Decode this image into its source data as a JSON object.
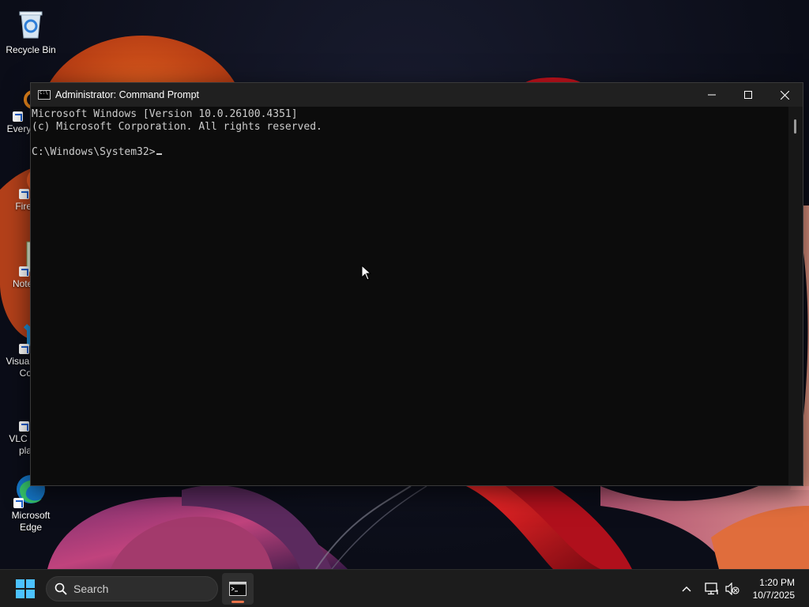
{
  "desktop": {
    "icons": [
      {
        "label": "Recycle Bin",
        "icon": "recycle-bin-icon"
      },
      {
        "label": "Every",
        "icon": "everything-icon"
      },
      {
        "label": "Fire",
        "icon": "firefox-icon"
      },
      {
        "label": "Notep",
        "icon": "notepad-plus-plus-icon"
      },
      {
        "label": "Visual",
        "label2": "Co",
        "icon": "vscode-icon"
      },
      {
        "label": "VLC r",
        "label2": "pla",
        "icon": "vlc-icon"
      },
      {
        "label": "Microsoft",
        "label2": "Edge",
        "icon": "edge-icon"
      }
    ]
  },
  "window": {
    "title": "Administrator: Command Prompt",
    "controls": {
      "minimize": "minimize-icon",
      "maximize": "maximize-icon",
      "close": "close-icon"
    },
    "console_lines": [
      "Microsoft Windows [Version 10.0.26100.4351]",
      "(c) Microsoft Corporation. All rights reserved.",
      "",
      "C:\\Windows\\System32>"
    ]
  },
  "taskbar": {
    "search_placeholder": "Search",
    "pinned": [
      {
        "name": "Command Prompt",
        "icon": "terminal-icon",
        "active": true
      }
    ],
    "tray": {
      "chevron": "chevron-up-icon",
      "network": "network-icon",
      "volume": "volume-muted-icon"
    },
    "clock": {
      "time": "1:20 PM",
      "date": "10/7/2025"
    }
  },
  "colors": {
    "console_bg": "#0c0c0c",
    "console_text": "#cccccc",
    "titlebar_bg": "#202020",
    "taskbar_bg": "#1c1c1c",
    "accent": "#e8734a"
  }
}
